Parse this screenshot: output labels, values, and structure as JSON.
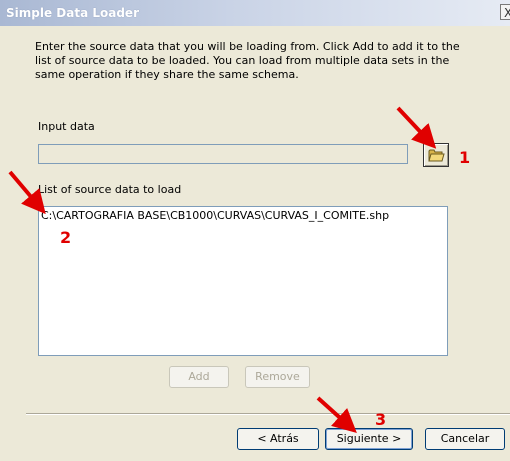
{
  "window": {
    "title": "Simple Data Loader",
    "close_label": "X"
  },
  "intro": {
    "text": "Enter the source data that you will be loading from. Click Add to add it to the list of source data to be loaded. You can load from multiple data sets in the same operation if they share the same schema."
  },
  "input": {
    "label": "Input data",
    "value": "",
    "browse_icon": "open-folder-icon"
  },
  "list": {
    "label": "List of source data to load",
    "items": [
      "C:\\CARTOGRAFIA BASE\\CB1000\\CURVAS\\CURVAS_I_COMITE.shp"
    ]
  },
  "buttons": {
    "add": "Add",
    "remove": "Remove",
    "back": "< Atrás",
    "next": "Siguiente >",
    "cancel": "Cancelar"
  },
  "annotations": {
    "marker_1": "1",
    "marker_2": "2",
    "marker_3": "3",
    "color": "#e00000"
  }
}
